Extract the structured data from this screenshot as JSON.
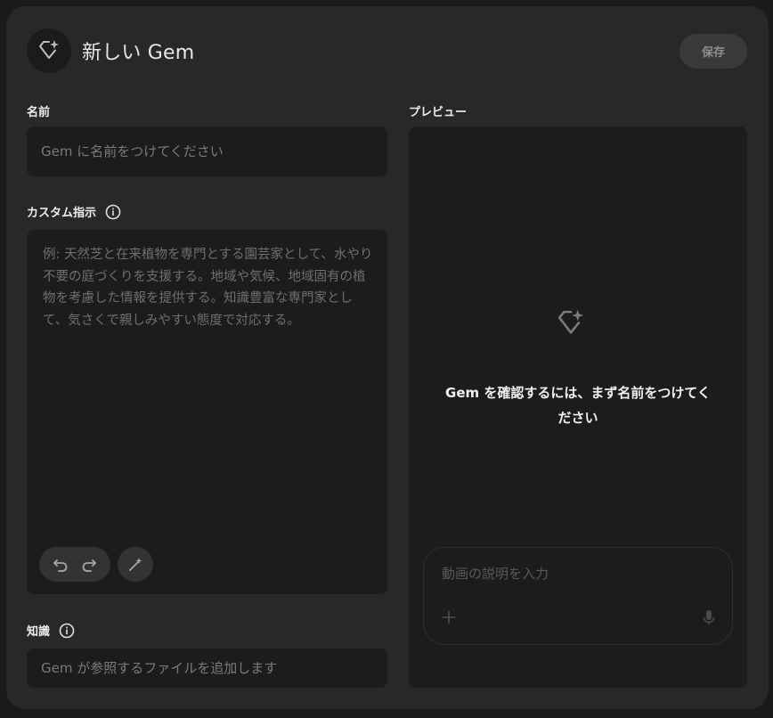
{
  "header": {
    "title": "新しい Gem",
    "save_label": "保存"
  },
  "name_section": {
    "label": "名前",
    "placeholder": "Gem に名前をつけてください"
  },
  "instructions_section": {
    "label": "カスタム指示",
    "placeholder": "例: 天然芝と在来植物を専門とする園芸家として、水やり不要の庭づくりを支援する。地域や気候、地域固有の植物を考慮した情報を提供する。知識豊富な専門家として、気さくで親しみやすい態度で対応する。"
  },
  "knowledge_section": {
    "label": "知識",
    "placeholder": "Gem が参照するファイルを追加します"
  },
  "preview": {
    "label": "プレビュー",
    "message": "Gem を確認するには、まず名前をつけてください",
    "prompt_placeholder": "動画の説明を入力"
  },
  "icons": {
    "header": "gem-sparkle-icon",
    "info": "info-icon",
    "undo": "undo-icon",
    "redo": "redo-icon",
    "magic": "magic-wand-icon",
    "add": "plus-icon",
    "mic": "microphone-icon"
  },
  "colors": {
    "card_bg": "#282829",
    "field_bg": "#1c1c1d",
    "page_bg": "#1a1a1b"
  }
}
